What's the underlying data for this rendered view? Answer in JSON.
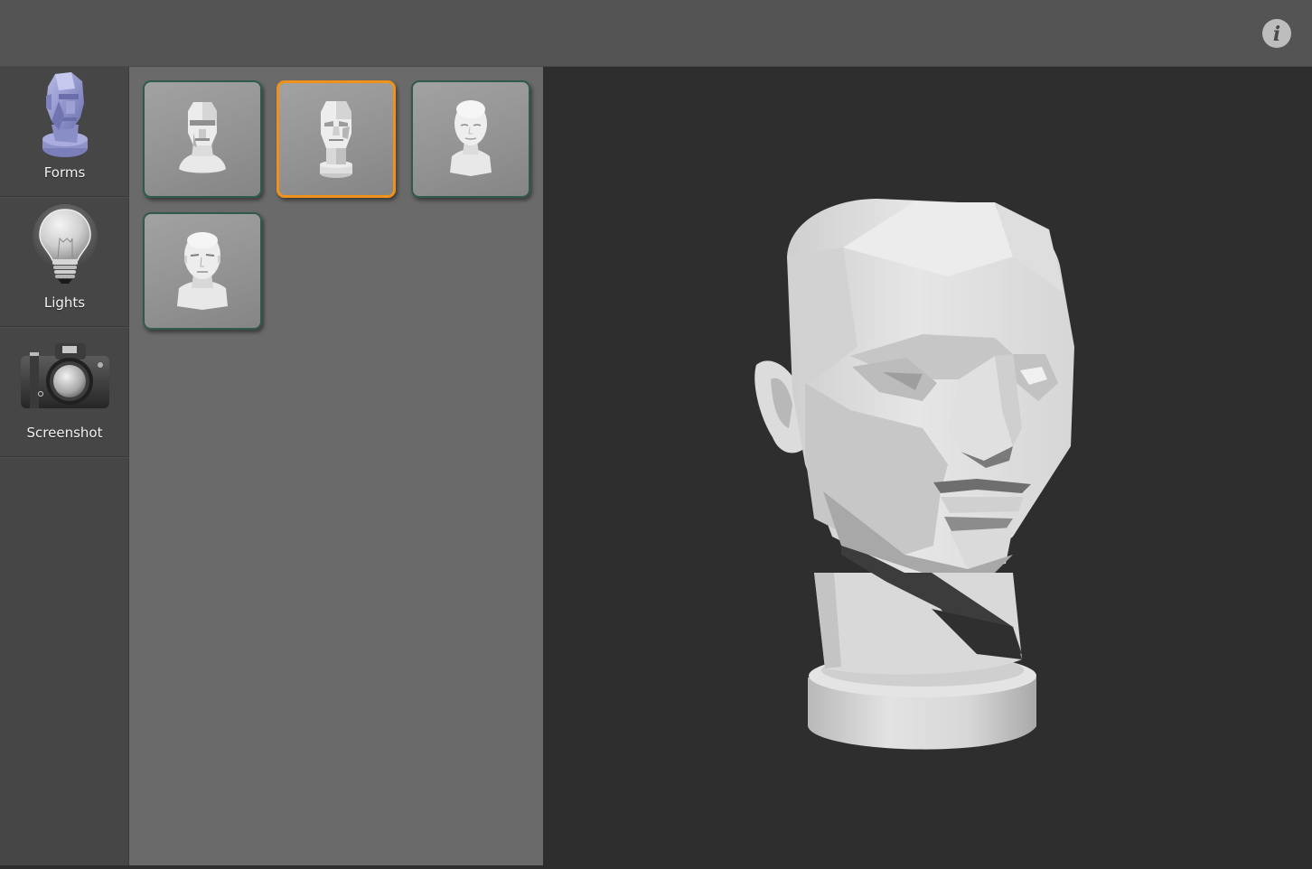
{
  "app": {
    "topbar": {
      "info_button_icon": "info-icon",
      "info_glyph": "i"
    },
    "sidebar": {
      "items": [
        {
          "id": "forms",
          "label": "Forms",
          "icon": "planar-head-icon",
          "active": true
        },
        {
          "id": "lights",
          "label": "Lights",
          "icon": "light-bulb-icon",
          "active": false
        },
        {
          "id": "screenshot",
          "label": "Screenshot",
          "icon": "camera-icon",
          "active": false
        }
      ]
    },
    "forms_panel": {
      "tiles": [
        {
          "id": "form-1",
          "description": "Planar head on rounded bust, boxy blocked features",
          "selected": false
        },
        {
          "id": "form-2",
          "description": "Asaro-style planar head on cylindrical base",
          "selected": true
        },
        {
          "id": "form-3",
          "description": "Smooth female head with shoulders",
          "selected": false
        },
        {
          "id": "form-4",
          "description": "Smooth male head with shoulders",
          "selected": false
        }
      ]
    },
    "viewport": {
      "model": "Asaro-style planar head on cylindrical pedestal"
    },
    "colors": {
      "topbar": "#545454",
      "sidebar": "#464646",
      "panel": "#6a6a6a",
      "viewport": "#2e2e2e",
      "tile_border": "#2f5a50",
      "selected_border": "#f0921a",
      "forms_icon_tint": "#8e92c8"
    }
  }
}
